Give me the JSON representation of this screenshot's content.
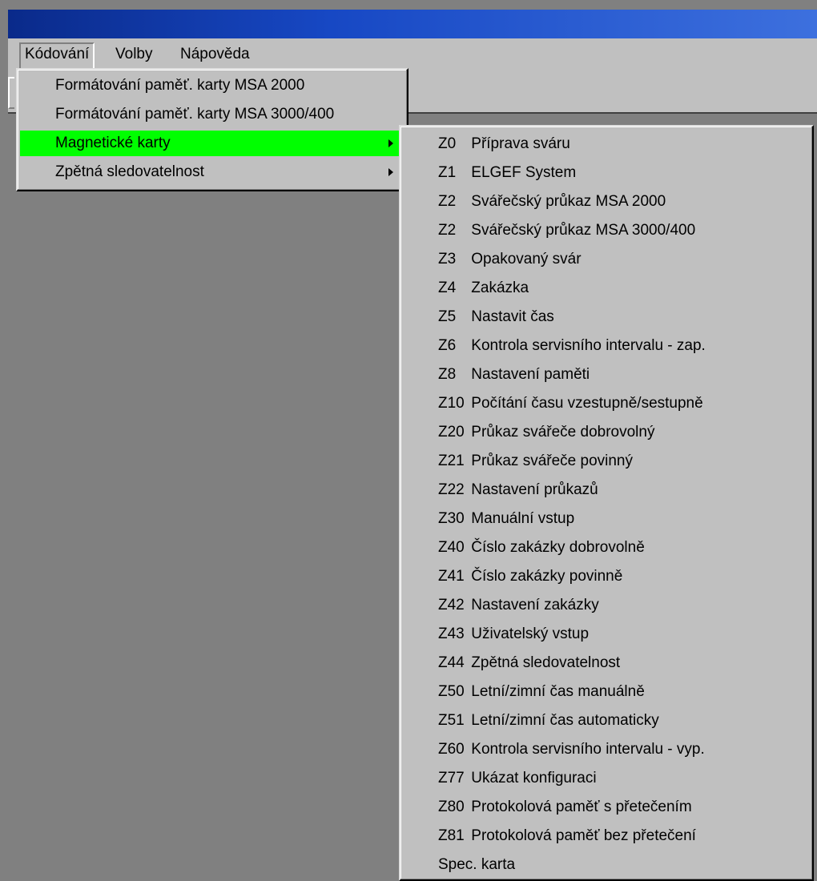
{
  "menubar": {
    "items": [
      "Kódování",
      "Volby",
      "Nápověda"
    ]
  },
  "kodovani_menu": {
    "items": [
      {
        "label": "Formátování paměť. karty MSA 2000"
      },
      {
        "label": "Formátování paměť. karty MSA 3000/400"
      },
      {
        "label": "Magnetické karty",
        "submenu": true,
        "highlighted": true
      },
      {
        "label": "Zpětná sledovatelnost",
        "submenu": true
      }
    ],
    "highlight_color": "#00ff00"
  },
  "magnetic_cards_menu": {
    "items": [
      {
        "code": "Z0",
        "text": "Příprava sváru"
      },
      {
        "code": "Z1",
        "text": "ELGEF System"
      },
      {
        "code": "Z2",
        "text": "Svářečský průkaz MSA 2000"
      },
      {
        "code": "Z2",
        "text": "Svářečský průkaz MSA 3000/400"
      },
      {
        "code": "Z3",
        "text": "Opakovaný svár"
      },
      {
        "code": "Z4",
        "text": "Zakázka"
      },
      {
        "code": "Z5",
        "text": "Nastavit čas"
      },
      {
        "code": "Z6",
        "text": "Kontrola servisního intervalu - zap."
      },
      {
        "code": "Z8",
        "text": "Nastavení paměti"
      },
      {
        "code": "Z10",
        "text": "Počítání času vzestupně/sestupně"
      },
      {
        "code": "Z20",
        "text": "Průkaz svářeče dobrovolný"
      },
      {
        "code": "Z21",
        "text": "Průkaz svářeče povinný"
      },
      {
        "code": "Z22",
        "text": "Nastavení průkazů"
      },
      {
        "code": "Z30",
        "text": "Manuální vstup"
      },
      {
        "code": "Z40",
        "text": "Číslo zakázky dobrovolně"
      },
      {
        "code": "Z41",
        "text": "Číslo zakázky povinně"
      },
      {
        "code": "Z42",
        "text": "Nastavení zakázky"
      },
      {
        "code": "Z43",
        "text": "Uživatelský vstup"
      },
      {
        "code": "Z44",
        "text": "Zpětná sledovatelnost"
      },
      {
        "code": "Z50",
        "text": "Letní/zimní čas manuálně"
      },
      {
        "code": "Z51",
        "text": "Letní/zimní čas automaticky"
      },
      {
        "code": "Z60",
        "text": "Kontrola servisního intervalu - vyp."
      },
      {
        "code": "Z77",
        "text": "Ukázat konfiguraci"
      },
      {
        "code": "Z80",
        "text": "Protokolová paměť s přetečením"
      },
      {
        "code": "Z81",
        "text": "Protokolová paměť bez přetečení"
      },
      {
        "code": "",
        "text": "Spec. karta"
      }
    ]
  },
  "colors": {
    "titlebar": "#0a2a8a",
    "face": "#c0c0c0",
    "workspace": "#808080"
  }
}
